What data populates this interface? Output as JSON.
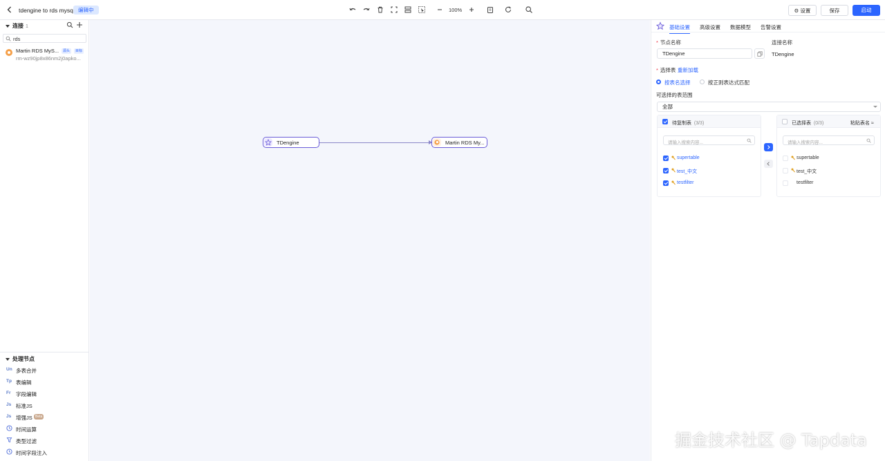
{
  "topbar": {
    "title": "tdengine to rds mysql",
    "status_badge": "编辑中",
    "zoom": "100%",
    "settings_label": "设置",
    "save_label": "保存",
    "start_label": "启动"
  },
  "sidebar": {
    "connections_title": "连接",
    "connections_count": "1",
    "search_value": "rds",
    "connection": {
      "name": "Martin RDS MyS...",
      "tag_source": "源头",
      "tag_target": "目标",
      "address": "rm-wz90jp8x86nm2j0apko..."
    },
    "processing_title": "处理节点",
    "processors": [
      {
        "icon": "Un",
        "label": "多表合并"
      },
      {
        "icon": "Tp",
        "label": "表编辑"
      },
      {
        "icon": "Fr",
        "label": "字段编辑"
      },
      {
        "icon": "Js",
        "label": "标准JS"
      },
      {
        "icon": "Js",
        "label": "增强JS",
        "badge": "Beta"
      },
      {
        "icon": "clock-icon",
        "label": "时间运算"
      },
      {
        "icon": "filter-icon",
        "label": "类型过滤"
      },
      {
        "icon": "clock-icon",
        "label": "时间字段注入"
      }
    ]
  },
  "canvas": {
    "source_node": "TDengine",
    "target_node": "Martin RDS My..."
  },
  "panel": {
    "tabs": [
      "基础设置",
      "高级设置",
      "数据模型",
      "告警设置"
    ],
    "active_tab": 0,
    "node_name_label": "节点名称",
    "node_name_value": "TDengine",
    "connection_name_label": "连接名称",
    "connection_name_value": "TDengine",
    "select_table_label": "选择表",
    "reload_link": "重新加载",
    "radio_by_name": "按表名选择",
    "radio_by_regex": "按正则表达式匹配",
    "range_label": "可选择的表范围",
    "range_value": "全部",
    "pending_title": "待复制表",
    "pending_count": "(3/3)",
    "selected_title": "已选择表",
    "selected_count": "(0/3)",
    "paste_link": "粘贴表名",
    "search_placeholder": "请输入搜索内容...",
    "pending_tables": [
      "supertable",
      "test_中文",
      "testfilter"
    ],
    "selected_tables": [
      "supertable",
      "test_中文",
      "testfilter"
    ]
  },
  "watermark": "掘金技术社区 @ Tapdata",
  "colors": {
    "accent": "#2c65ff",
    "node_border": "#6a5cd8",
    "canvas_bg": "#f4f6fc"
  }
}
